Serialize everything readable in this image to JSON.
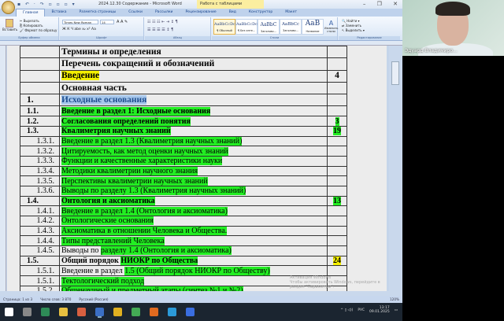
{
  "window": {
    "title": "2024.12.30 Содержание - Microsoft Word",
    "context_tab": "Работа с таблицами",
    "qat": "▪ ↶ · ↷ ▫ ▫ ▫ ▾"
  },
  "tabs": [
    "Главная",
    "Вставка",
    "Разметка страницы",
    "Ссылки",
    "Рассылки",
    "Рецензирование",
    "Вид",
    "Конструктор",
    "Макет"
  ],
  "ribbon": {
    "clipboard": {
      "label": "Буфер обмена",
      "paste": "Вставить",
      "cut": "Вырезать",
      "copy": "Копировать",
      "format_painter": "Формат по образцу"
    },
    "font": {
      "label": "Шрифт",
      "family": "Times New Roman",
      "size": "14",
      "buttons": "Ж  К  Ч  abe  x₂  x²  Aa"
    },
    "paragraph": {
      "label": "Абзац",
      "buttons": "☰ ☰ ☰ ☰  ↕  ¶"
    },
    "styles": {
      "label": "Стили",
      "items": [
        {
          "sample": "AaBbCcDc",
          "name": "¶ Обычный"
        },
        {
          "sample": "AaBbCcDc",
          "name": "¶ Без инте..."
        },
        {
          "sample": "AaBbC",
          "name": "Заголово..."
        },
        {
          "sample": "AaBbCc",
          "name": "Заголово..."
        },
        {
          "sample": "AaB",
          "name": "Название"
        }
      ],
      "change": "Изменить стили"
    },
    "editing": {
      "label": "Редактирование",
      "find": "Найти",
      "replace": "Заменить",
      "select": "Выделить"
    }
  },
  "toc": [
    {
      "num": "",
      "pre": "",
      "text": "Термины и определения",
      "page": "",
      "lvl": "top"
    },
    {
      "num": "",
      "pre": "",
      "text": "Перечень сокращений и обозначений",
      "page": "",
      "lvl": "top"
    },
    {
      "num": "",
      "pre": "",
      "text": "Введение",
      "page": "4",
      "lvl": "top",
      "hl": "y"
    },
    {
      "num": "",
      "pre": "",
      "text": "Основная часть",
      "page": "",
      "lvl": "top"
    },
    {
      "num": "1.",
      "pre": "",
      "text": "Исходные основания",
      "page": "",
      "lvl": "top",
      "hl": "b"
    },
    {
      "num": "1.1.",
      "pre": "",
      "text": "Введение в раздел 1: Исходные основания",
      "page": "",
      "lvl": "bold",
      "hl": "g"
    },
    {
      "num": "1.2.",
      "pre": "",
      "text": "Согласования определений понятия",
      "page": "3",
      "lvl": "bold",
      "hl": "g",
      "phl": "g"
    },
    {
      "num": "1.3.",
      "pre": "",
      "text": "Квалиметрия научных знаний",
      "page": "19",
      "lvl": "bold",
      "hl": "g",
      "phl": "g"
    },
    {
      "num": "1.3.1.",
      "pre": "",
      "text": "Введение в раздел 1.3 (Квалиметрия научных знаний)",
      "page": "",
      "lvl": "sub",
      "hl": "g"
    },
    {
      "num": "1.3.2.",
      "pre": "",
      "text": "Цитируемость, как метод оценки научных знаний",
      "page": "",
      "lvl": "sub",
      "hl": "g"
    },
    {
      "num": "1.3.3.",
      "pre": "",
      "text": "Функции и качественные характеристики науки",
      "page": "",
      "lvl": "sub",
      "hl": "g"
    },
    {
      "num": "1.3.4.",
      "pre": "",
      "text": "Методики квалиметрии научного знания",
      "page": "",
      "lvl": "sub",
      "hl": "g"
    },
    {
      "num": "1.3.5.",
      "pre": "",
      "text": "Перспективы квалиметрии научных знаний",
      "page": "",
      "lvl": "sub",
      "hl": "g"
    },
    {
      "num": "1.3.6.",
      "pre": "",
      "text": "Выводы по разделу 1.3 (Квалиметрия научных знаний)",
      "page": "",
      "lvl": "sub",
      "hl": "g"
    },
    {
      "num": "1.4.",
      "pre": "",
      "text": "Онтология и аксиоматика",
      "page": "13",
      "lvl": "bold",
      "hl": "g",
      "phl": "g"
    },
    {
      "num": "1.4.1.",
      "pre": "",
      "text": "Введение в раздел 1.4 (Онтология и аксиоматика)",
      "page": "",
      "lvl": "sub",
      "hl": "g"
    },
    {
      "num": "1.4.2.",
      "pre": "",
      "text": "Онтологические основания",
      "page": "",
      "lvl": "sub",
      "hl": "g"
    },
    {
      "num": "1.4.3.",
      "pre": "",
      "text": "Аксиоматика в отношении Человека и Общества.",
      "page": "",
      "lvl": "sub",
      "hl": "g"
    },
    {
      "num": "1.4.4.",
      "pre": "",
      "text": "Типы представлений Человека",
      "page": "",
      "lvl": "sub",
      "hl": "g"
    },
    {
      "num": "1.4.5.",
      "pre": "Выводы по ",
      "text": "разделу 1.4 (Онтология и аксиоматика)",
      "page": "",
      "lvl": "sub",
      "hl": "g"
    },
    {
      "num": "1.5.",
      "pre": "Общий порядок ",
      "text": "НИОКР по Общества",
      "page": "24",
      "lvl": "bold",
      "hl": "g",
      "phl": "y"
    },
    {
      "num": "1.5.1.",
      "pre": "Введение в раздел ",
      "text": "1.5 (Общий порядок НИОКР по Обществу)",
      "page": "",
      "lvl": "sub",
      "hl": "g"
    },
    {
      "num": "1.5.1.",
      "pre": "",
      "text": "Тектологический подход",
      "page": "",
      "lvl": "sub",
      "hl": "g"
    },
    {
      "num": "1.5.2.",
      "pre": "",
      "text": "Общенаучный и предметный этапы (синтез №1 и №2)",
      "page": "",
      "lvl": "sub",
      "hl": "g"
    }
  ],
  "watermark": {
    "line1": "Активация Windows",
    "line2": "Чтобы активировать Windows, перейдите в",
    "line3": "раздел \"Параметры\"."
  },
  "status": {
    "page": "Страница: 1 из 3",
    "words": "Число слов: 3 870",
    "lang": "Русский (Россия)",
    "zoom": "120%"
  },
  "taskbar": {
    "lang": "РУС",
    "time": "13:17",
    "date": "09.01.2025",
    "icons": [
      {
        "name": "start",
        "color": "#ffffff"
      },
      {
        "name": "task-view",
        "color": "#888888"
      },
      {
        "name": "excel",
        "color": "#2e8b57"
      },
      {
        "name": "explorer",
        "color": "#e8c040"
      },
      {
        "name": "powerpoint",
        "color": "#d86040"
      },
      {
        "name": "word",
        "color": "#3b6fc4"
      },
      {
        "name": "chrome",
        "color": "#e0b020"
      },
      {
        "name": "chrome-2",
        "color": "#44aa55"
      },
      {
        "name": "app-orange",
        "color": "#e06a20"
      },
      {
        "name": "edge",
        "color": "#2b9ad8"
      },
      {
        "name": "app-blue",
        "color": "#3a6ee0"
      }
    ]
  },
  "webcam": {
    "name": "Эдуард Владимиро..."
  },
  "colors": {
    "green_highlight": "#22ee22",
    "yellow_highlight": "#f5f000",
    "selection": "#a8c8ec"
  }
}
